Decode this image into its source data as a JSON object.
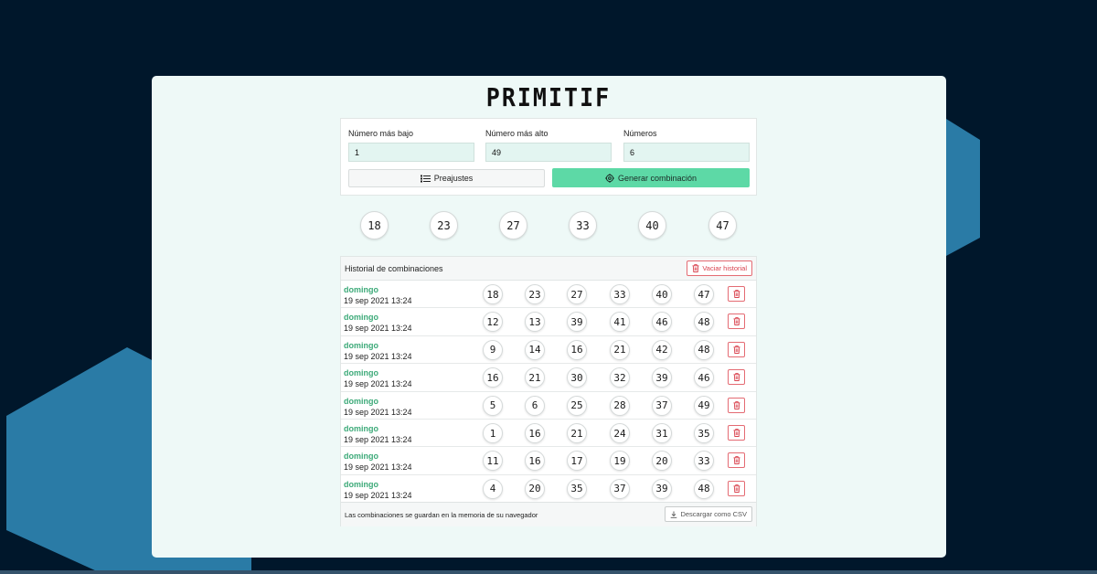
{
  "app": {
    "logo_text": "PRIMITIF"
  },
  "colors": {
    "background": "#00172b",
    "hexagon": "#2a7ba6",
    "card": "#eef9f7",
    "accent": "#5dd9a6",
    "danger": "#d9434f",
    "day_text": "#3daa79"
  },
  "form": {
    "low": {
      "label": "Número más bajo",
      "value": "1"
    },
    "high": {
      "label": "Número más alto",
      "value": "49"
    },
    "count": {
      "label": "Números",
      "value": "6"
    },
    "presets_label": "Preajustes",
    "presets_icon": "list-icon",
    "generate_label": "Generar combinación",
    "generate_icon": "settings-gear-icon"
  },
  "current_numbers": [
    "18",
    "23",
    "27",
    "33",
    "40",
    "47"
  ],
  "history": {
    "title": "Historial de combinaciones",
    "clear_label": "Vaciar historial",
    "clear_icon": "trash-icon",
    "rows": [
      {
        "day": "domingo",
        "date": "19 sep 2021 13:24",
        "numbers": [
          "18",
          "23",
          "27",
          "33",
          "40",
          "47"
        ]
      },
      {
        "day": "domingo",
        "date": "19 sep 2021 13:24",
        "numbers": [
          "12",
          "13",
          "39",
          "41",
          "46",
          "48"
        ]
      },
      {
        "day": "domingo",
        "date": "19 sep 2021 13:24",
        "numbers": [
          "9",
          "14",
          "16",
          "21",
          "42",
          "48"
        ]
      },
      {
        "day": "domingo",
        "date": "19 sep 2021 13:24",
        "numbers": [
          "16",
          "21",
          "30",
          "32",
          "39",
          "46"
        ]
      },
      {
        "day": "domingo",
        "date": "19 sep 2021 13:24",
        "numbers": [
          "5",
          "6",
          "25",
          "28",
          "37",
          "49"
        ]
      },
      {
        "day": "domingo",
        "date": "19 sep 2021 13:24",
        "numbers": [
          "1",
          "16",
          "21",
          "24",
          "31",
          "35"
        ]
      },
      {
        "day": "domingo",
        "date": "19 sep 2021 13:24",
        "numbers": [
          "11",
          "16",
          "17",
          "19",
          "20",
          "33"
        ]
      },
      {
        "day": "domingo",
        "date": "19 sep 2021 13:24",
        "numbers": [
          "4",
          "20",
          "35",
          "37",
          "39",
          "48"
        ]
      }
    ],
    "footer_note": "Las combinaciones se guardan en la memoria de su navegador",
    "download_label": "Descargar como CSV",
    "download_icon": "download-icon"
  }
}
